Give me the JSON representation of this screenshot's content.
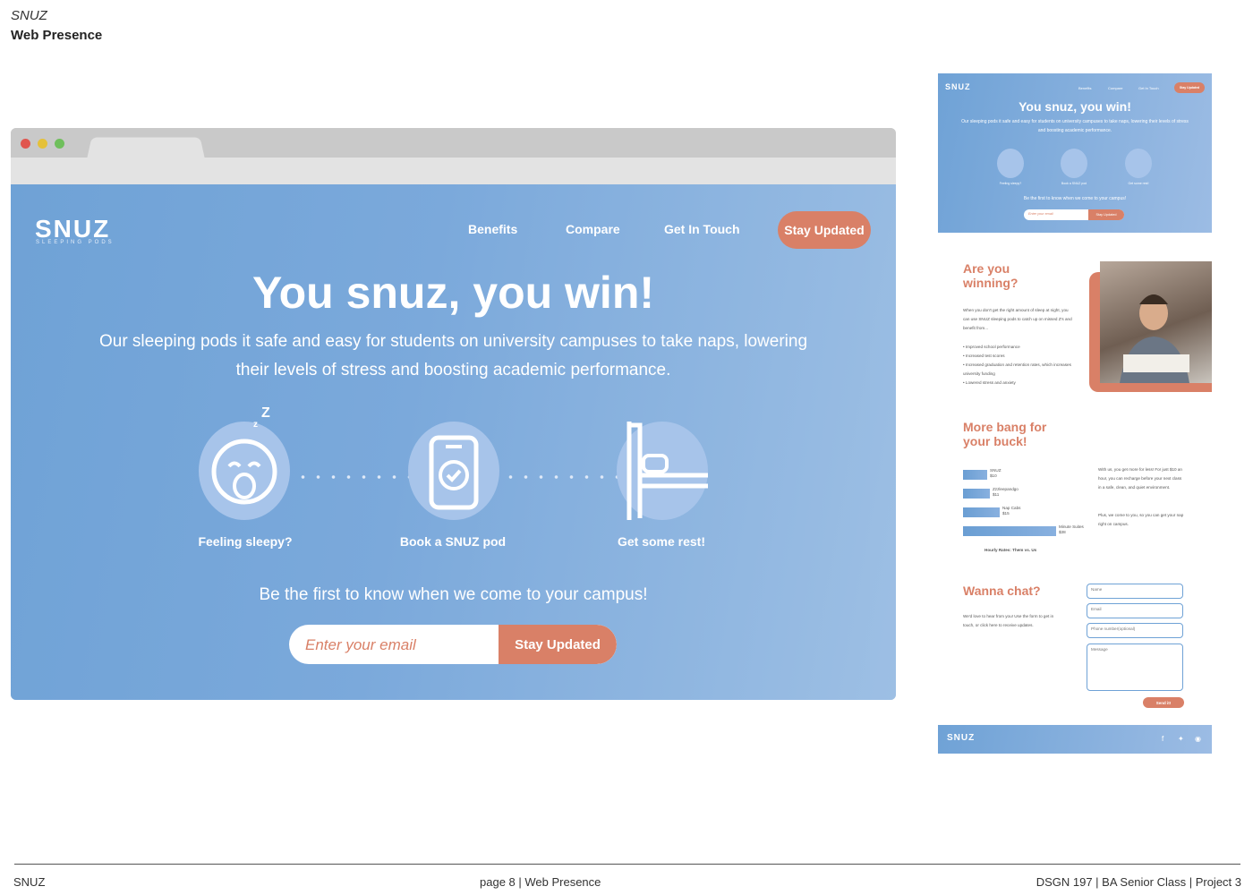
{
  "document": {
    "subtitle": "SNUZ",
    "title": "Web Presence"
  },
  "site": {
    "logo": "SNUZ",
    "tagline": "SLEEPING PODS",
    "nav": [
      "Benefits",
      "Compare",
      "Get In Touch"
    ],
    "cta": "Stay Updated",
    "hero_title": "You snuz, you win!",
    "hero_sub": "Our sleeping pods it safe and easy for students on university campuses to take naps, lowering their levels of stress and boosting academic performance.",
    "steps": [
      "Feeling sleepy?",
      "Book a SNUZ pod",
      "Get some rest!"
    ],
    "signup_heading": "Be the first to know when we come to your campus!",
    "email_placeholder": "Enter your email",
    "signup_button": "Stay Updated"
  },
  "mobile": {
    "logo": "SNUZ",
    "nav": [
      "Benefits",
      "Compare",
      "Get In Touch"
    ],
    "cta": "Stay Updated",
    "hero_title": "You snuz, you win!",
    "hero_sub": "Our sleeping pods it safe and easy for students on university campuses to take naps, lowering their levels of stress and boosting academic performance.",
    "steps": [
      "Feeling sleepy?",
      "Book a SNUZ pod",
      "Get some rest!"
    ],
    "signup_heading": "Be the first to know when we come to your campus!",
    "email_placeholder": "Enter your email",
    "signup_button": "Stay Updated",
    "winning": {
      "heading": "Are you winning?",
      "text": "When you don't get the right amount of sleep at night, you can use SNUZ sleeping pods to catch up on missed Z's and benefit from...",
      "bullets": [
        "• Improved school performance",
        "• Increased test scores",
        "• Increased graduation and retention rates, which increases university funding",
        "• Lowered stress and anxiety"
      ]
    },
    "bang": {
      "heading": "More bang for your buck!",
      "bars": [
        {
          "name": "SNUZ",
          "price": "$10",
          "value": 10
        },
        {
          "name": "Zzzleepandgo",
          "price": "$11",
          "value": 11
        },
        {
          "name": "Nap Cabs",
          "price": "$15",
          "value": 15
        },
        {
          "name": "Minute Suites",
          "price": "$38",
          "value": 38
        }
      ],
      "caption": "Hourly Rates: Them vs. Us",
      "text1": "With us, you get more for less! For just $10 an hour, you can recharge before your next class in a safe, clean, and quiet environment.",
      "text2": "Plus, we come to you, so you can get your nap right on campus."
    },
    "chat": {
      "heading": "Wanna chat?",
      "text": "We'd love to hear from you! Use the form to get in touch, or click here to receive updates.",
      "fields": [
        "Name",
        "Email",
        "Phone number(optional)",
        "Message"
      ],
      "send": "Send it!"
    },
    "footer_logo": "SNUZ"
  },
  "footer": {
    "left": "SNUZ",
    "center": "page 8  | Web Presence",
    "right": "DSGN 197 | BA Senior Class | Project 3"
  },
  "colors": {
    "accent": "#d98067",
    "hero_blue": "#6fa2d6"
  }
}
